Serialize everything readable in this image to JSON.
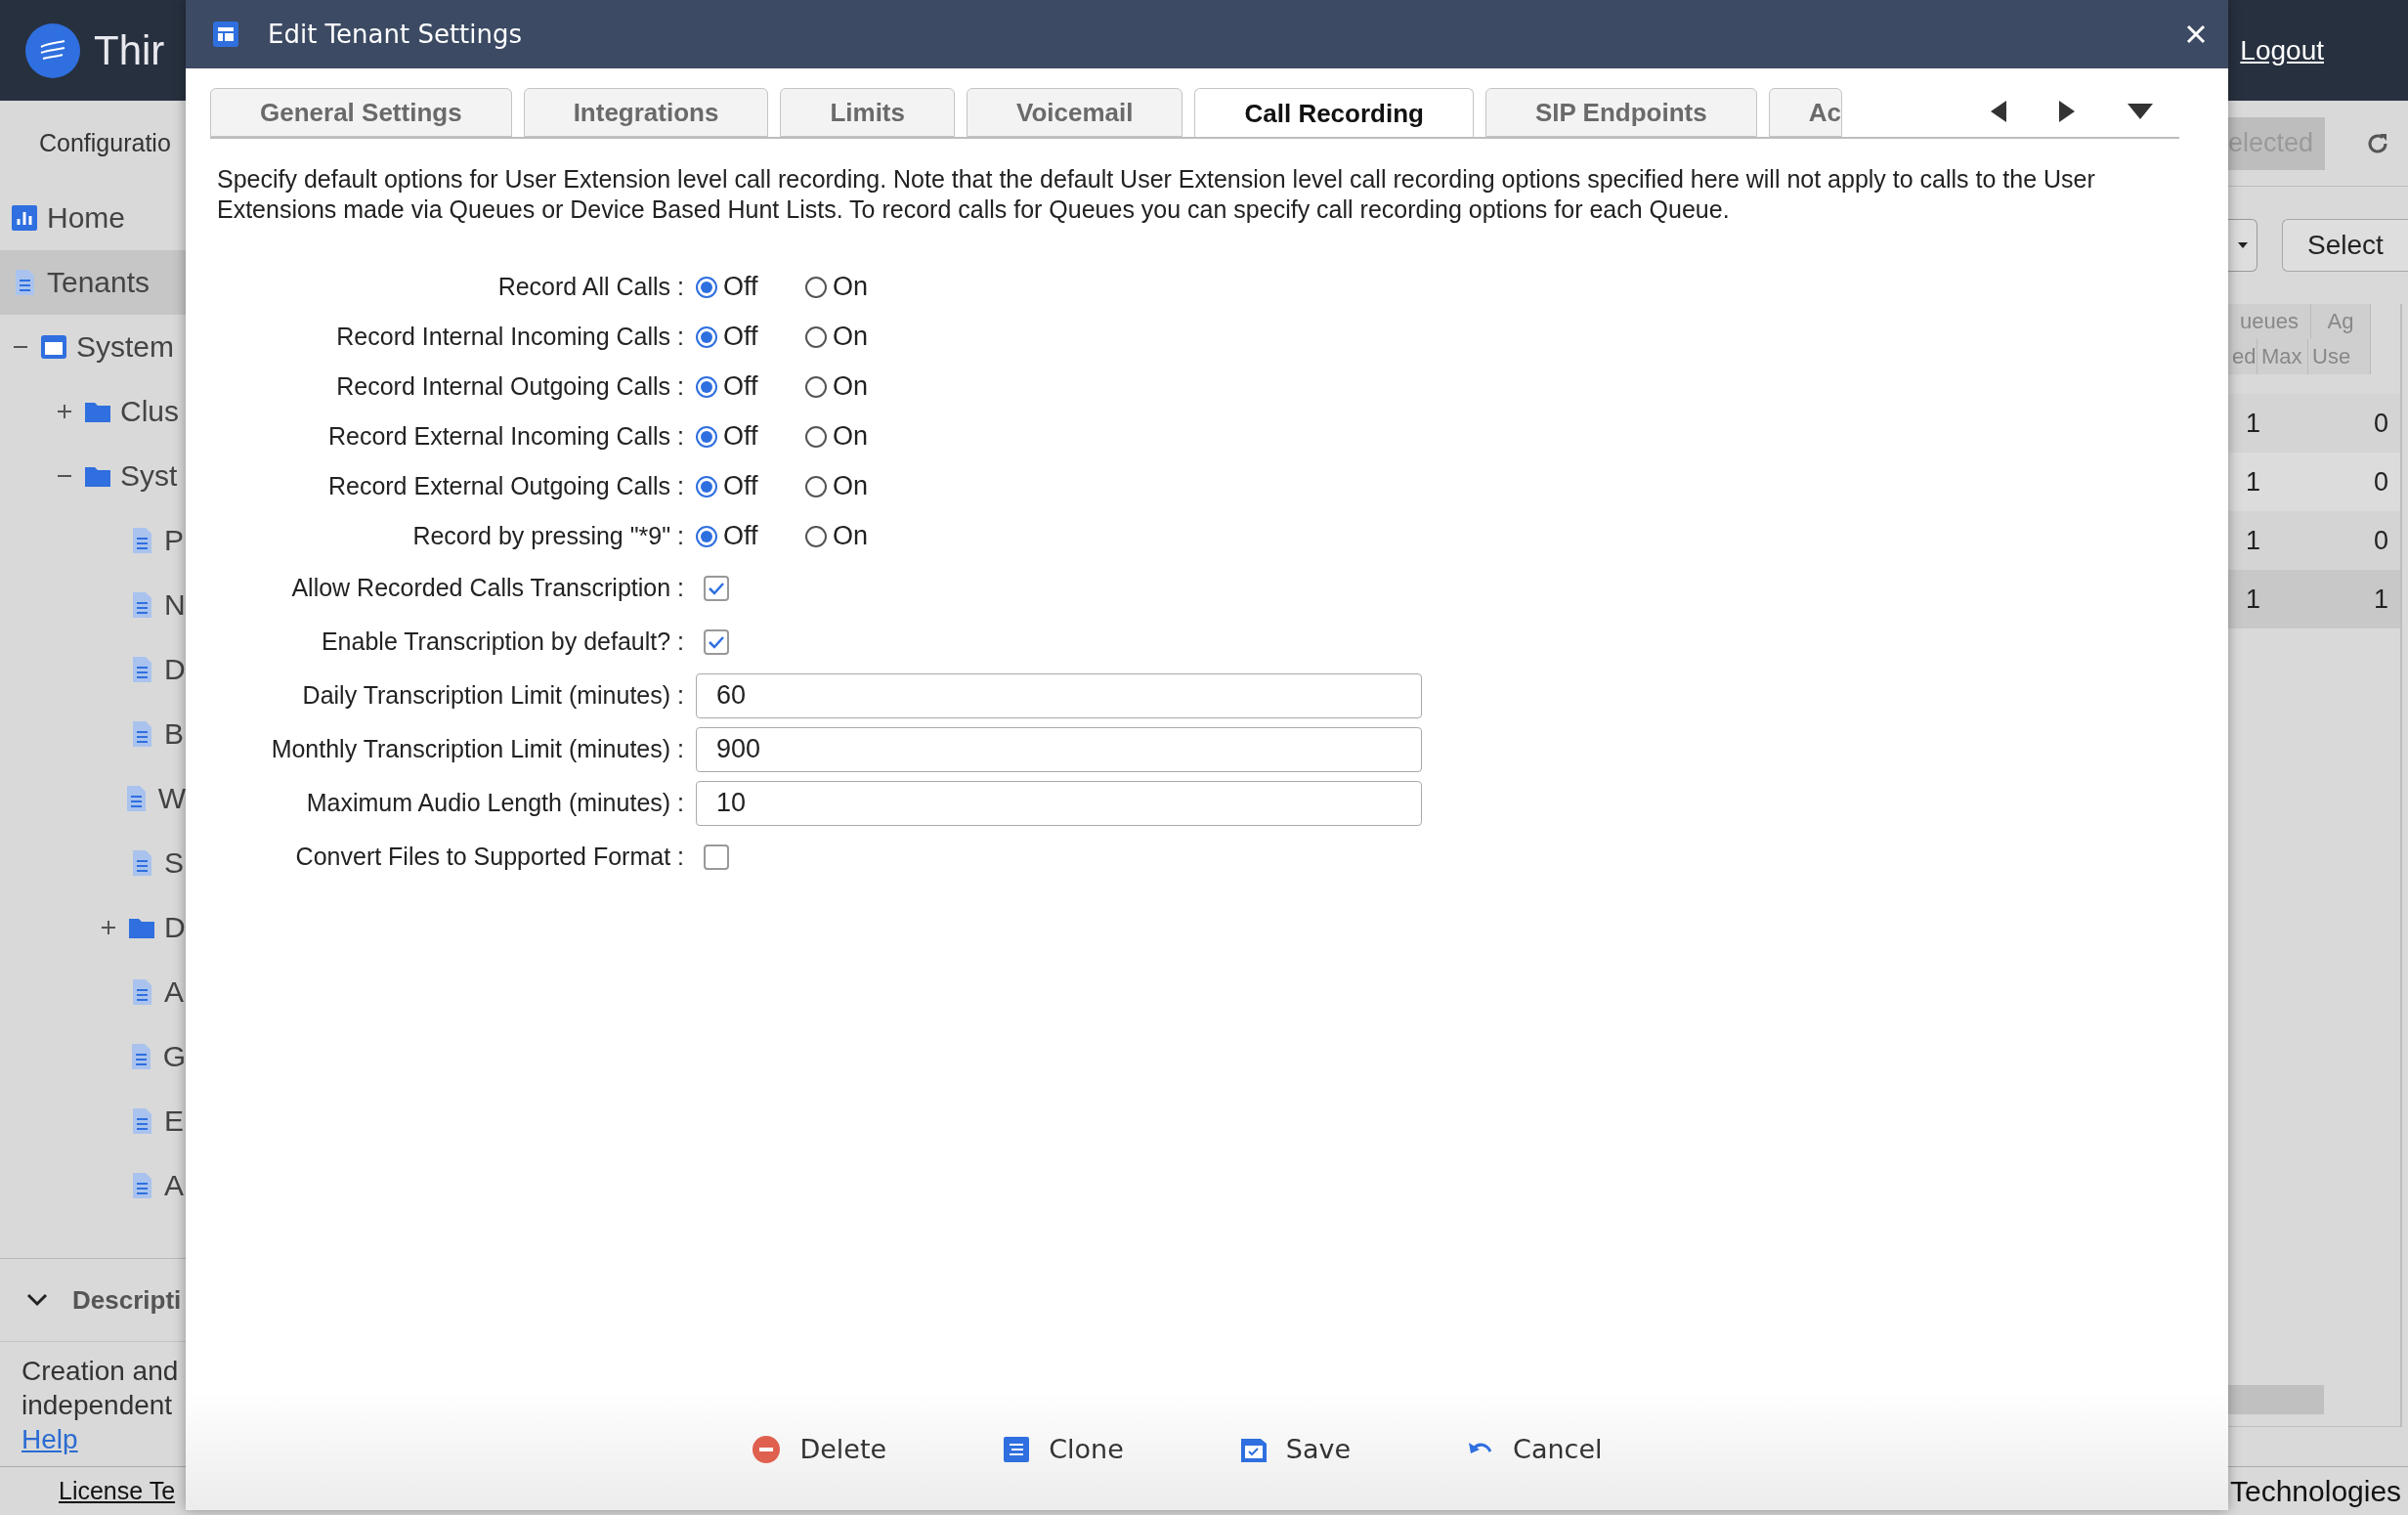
{
  "app": {
    "title": "Thir",
    "logout": "Logout"
  },
  "sidebar": {
    "heading": "Configuratio",
    "items": [
      {
        "label": "Home",
        "kind": "dashboard",
        "selected": false
      },
      {
        "label": "Tenants",
        "kind": "page",
        "selected": true
      },
      {
        "label": "System",
        "kind": "system",
        "selected": false,
        "expanded": true,
        "children": [
          {
            "label": "Clus",
            "kind": "folder",
            "selected": false,
            "expanded": false
          },
          {
            "label": "Syst",
            "kind": "folder",
            "selected": false,
            "expanded": true,
            "children": [
              {
                "label": "P",
                "kind": "page",
                "selected": false
              },
              {
                "label": "N",
                "kind": "page",
                "selected": false
              },
              {
                "label": "D",
                "kind": "page",
                "selected": false
              },
              {
                "label": "B",
                "kind": "page",
                "selected": false
              },
              {
                "label": "W",
                "kind": "page",
                "selected": false
              },
              {
                "label": "S",
                "kind": "page",
                "selected": false
              },
              {
                "label": "D",
                "kind": "folder",
                "selected": false,
                "expanded": false
              },
              {
                "label": "A",
                "kind": "page",
                "selected": false
              },
              {
                "label": "G",
                "kind": "page",
                "selected": false
              },
              {
                "label": "E",
                "kind": "page",
                "selected": false
              },
              {
                "label": "A",
                "kind": "page",
                "selected": false
              }
            ]
          }
        ]
      }
    ]
  },
  "description": {
    "title": "Descripti",
    "expanded": true,
    "lines": [
      "Creation and",
      "independent"
    ],
    "help": "Help"
  },
  "footer": {
    "left": "License Te",
    "right": "Technologies"
  },
  "right_panel": {
    "selected_button": "elected",
    "select_button": "Select",
    "header_top": [
      "ueues",
      "Ag"
    ],
    "header_sub": [
      "ed",
      "Max",
      "Use"
    ],
    "rows": [
      {
        "cells": [
          "1",
          "0"
        ],
        "selected": false
      },
      {
        "cells": [
          "1",
          "0"
        ],
        "selected": false
      },
      {
        "cells": [
          "1",
          "0"
        ],
        "selected": false
      },
      {
        "cells": [
          "1",
          "1"
        ],
        "selected": true
      }
    ]
  },
  "dialog": {
    "title": "Edit Tenant Settings",
    "tabs": [
      {
        "label": "General Settings",
        "selected": false
      },
      {
        "label": "Integrations",
        "selected": false
      },
      {
        "label": "Limits",
        "selected": false
      },
      {
        "label": "Voicemail",
        "selected": false
      },
      {
        "label": "Call Recording",
        "selected": true
      },
      {
        "label": "SIP Endpoints",
        "selected": false
      },
      {
        "label": "Ac",
        "selected": false
      }
    ],
    "intro": "Specify default options for User Extension level call recording. Note that the default User Extension level call recording options specified here will not apply to calls to the User Extensions made via Queues or Device Based Hunt Lists. To record calls for Queues you can specify call recording options for each Queue.",
    "fields": [
      {
        "kind": "radio",
        "label": "Record All Calls :",
        "options": [
          {
            "label": "Off",
            "selected": true
          },
          {
            "label": "On",
            "selected": false
          }
        ]
      },
      {
        "kind": "radio",
        "label": "Record Internal Incoming Calls :",
        "options": [
          {
            "label": "Off",
            "selected": true
          },
          {
            "label": "On",
            "selected": false
          }
        ]
      },
      {
        "kind": "radio",
        "label": "Record Internal Outgoing Calls :",
        "options": [
          {
            "label": "Off",
            "selected": true
          },
          {
            "label": "On",
            "selected": false
          }
        ]
      },
      {
        "kind": "radio",
        "label": "Record External Incoming Calls :",
        "options": [
          {
            "label": "Off",
            "selected": true
          },
          {
            "label": "On",
            "selected": false
          }
        ]
      },
      {
        "kind": "radio",
        "label": "Record External Outgoing Calls :",
        "options": [
          {
            "label": "Off",
            "selected": true
          },
          {
            "label": "On",
            "selected": false
          }
        ]
      },
      {
        "kind": "radio",
        "label": "Record by pressing \"*9\"  :",
        "options": [
          {
            "label": "Off",
            "selected": true
          },
          {
            "label": "On",
            "selected": false
          }
        ]
      },
      {
        "kind": "checkbox",
        "label": "Allow Recorded Calls Transcription :",
        "checked": true
      },
      {
        "kind": "checkbox",
        "label": "Enable Transcription by default?  :",
        "checked": true
      },
      {
        "kind": "text",
        "label": "Daily Transcription Limit (minutes) :",
        "value": "60"
      },
      {
        "kind": "text",
        "label": "Monthly Transcription Limit (minutes) :",
        "value": "900"
      },
      {
        "kind": "text",
        "label": "Maximum Audio Length (minutes) :",
        "value": "10"
      },
      {
        "kind": "checkbox",
        "label": "Convert Files to Supported Format :",
        "checked": false
      }
    ],
    "buttons": [
      {
        "kind": "delete",
        "label": "Delete"
      },
      {
        "kind": "clone",
        "label": "Clone"
      },
      {
        "kind": "save",
        "label": "Save"
      },
      {
        "kind": "cancel",
        "label": "Cancel"
      }
    ]
  }
}
